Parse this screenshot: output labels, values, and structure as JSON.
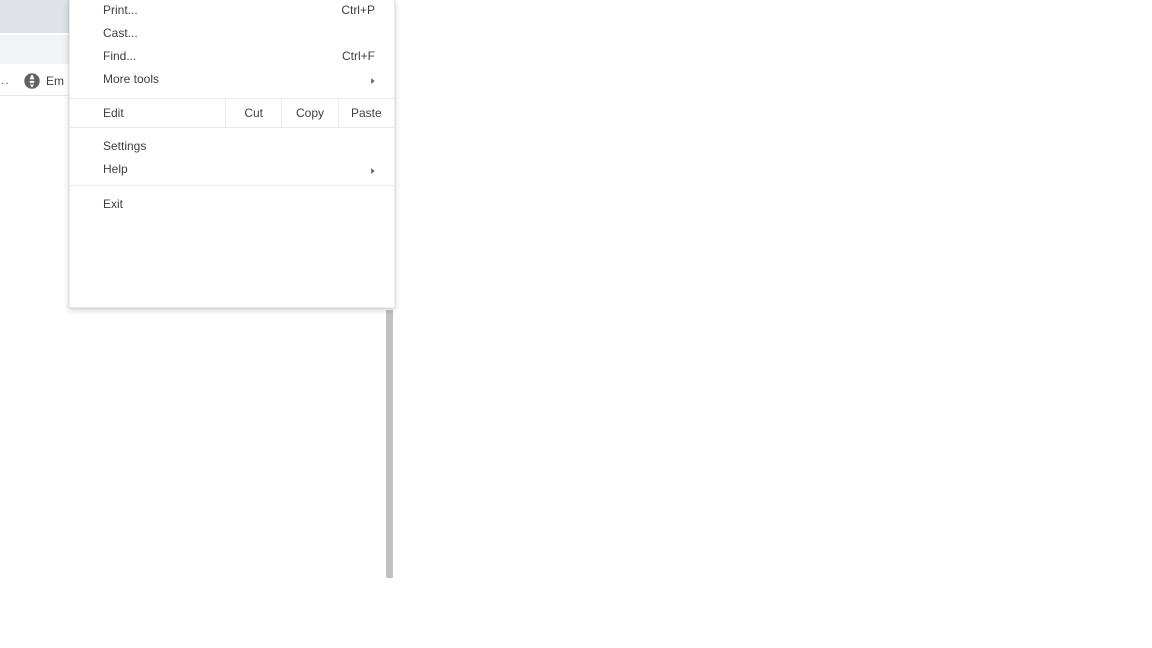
{
  "browser": {
    "tab_strip": {
      "color": "#dee1e6"
    },
    "toolbar": {
      "color": "#f1f3f4"
    },
    "bookmarks_bar": {
      "overflow_label": "..",
      "items": [
        {
          "icon": "globe-icon",
          "label": "Em"
        }
      ]
    },
    "scrollbar": {
      "thumb_color": "#c1c1c1"
    }
  },
  "menu": {
    "name": "chrome-main-menu",
    "groups": [
      {
        "items": [
          {
            "label": "Print...",
            "accel": "Ctrl+P",
            "submenu": false
          },
          {
            "label": "Cast...",
            "accel": "",
            "submenu": false
          },
          {
            "label": "Find...",
            "accel": "Ctrl+F",
            "submenu": false
          },
          {
            "label": "More tools",
            "accel": "",
            "submenu": true
          }
        ]
      }
    ],
    "edit_row": {
      "label": "Edit",
      "buttons": [
        "Cut",
        "Copy",
        "Paste"
      ]
    },
    "lower_items": [
      {
        "label": "Settings",
        "accel": "",
        "submenu": false
      },
      {
        "label": "Help",
        "accel": "",
        "submenu": true
      }
    ],
    "exit_item": {
      "label": "Exit",
      "accel": "",
      "submenu": false
    },
    "colors": {
      "background": "#ffffff",
      "text": "#3c4043",
      "separator": "#e8eaed"
    }
  }
}
